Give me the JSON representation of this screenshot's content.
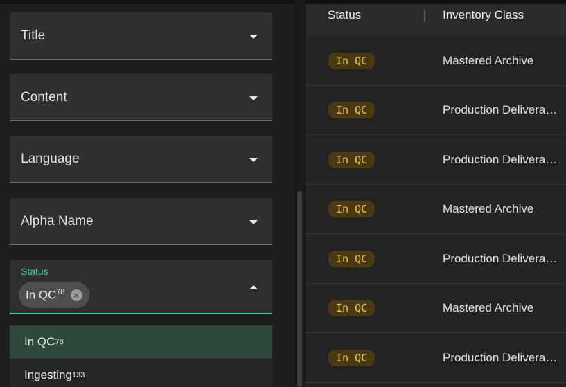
{
  "filters": {
    "fields": [
      {
        "label": "Title"
      },
      {
        "label": "Content"
      },
      {
        "label": "Language"
      },
      {
        "label": "Alpha Name"
      }
    ],
    "status": {
      "label": "Status",
      "chip": {
        "text": "In QC",
        "count": "78"
      },
      "options": [
        {
          "text": "In QC",
          "count": "78"
        },
        {
          "text": "Ingesting",
          "count": "133"
        }
      ]
    }
  },
  "table": {
    "headers": {
      "status": "Status",
      "inventory_class": "Inventory Class"
    },
    "rows": [
      {
        "status": "In QC",
        "inventory_class": "Mastered Archive"
      },
      {
        "status": "In QC",
        "inventory_class": "Production Deliverable"
      },
      {
        "status": "In QC",
        "inventory_class": "Production Deliverable"
      },
      {
        "status": "In QC",
        "inventory_class": "Mastered Archive"
      },
      {
        "status": "In QC",
        "inventory_class": "Production Deliverable"
      },
      {
        "status": "In QC",
        "inventory_class": "Mastered Archive"
      },
      {
        "status": "In QC",
        "inventory_class": "Production Deliverable"
      }
    ]
  },
  "colors": {
    "accent": "#3fcf8e",
    "badge_text": "#f2c94c",
    "badge_bg": "#4a3a14",
    "selected_option_bg": "#2c4a3a"
  }
}
